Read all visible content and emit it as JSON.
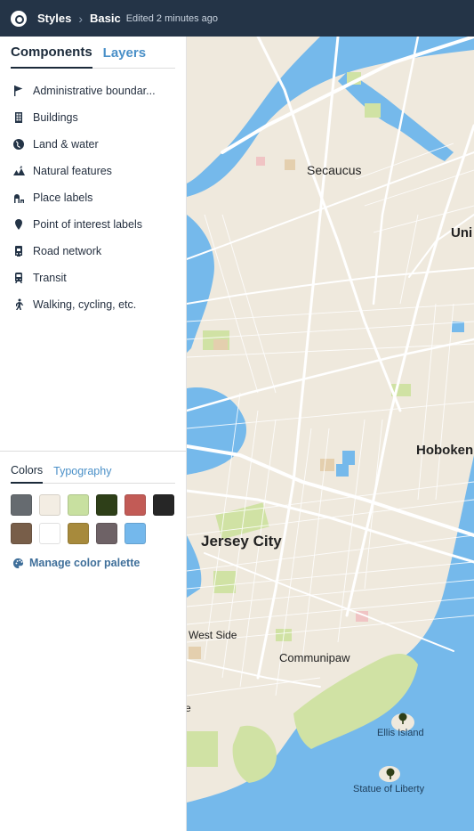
{
  "topbar": {
    "logo_icon": "mapbox-logo-icon",
    "styles_label": "Styles",
    "basic_label": "Basic",
    "edited_text": "Edited 2 minutes ago"
  },
  "sidebar": {
    "tabs": [
      {
        "label": "Components",
        "active": true
      },
      {
        "label": "Layers",
        "active": false
      }
    ],
    "components": [
      {
        "label": "Administrative boundar...",
        "icon": "flag-icon"
      },
      {
        "label": "Buildings",
        "icon": "building-icon"
      },
      {
        "label": "Land & water",
        "icon": "globe-icon"
      },
      {
        "label": "Natural features",
        "icon": "mountain-icon"
      },
      {
        "label": "Place labels",
        "icon": "place-label-icon"
      },
      {
        "label": "Point of interest labels",
        "icon": "marker-icon"
      },
      {
        "label": "Road network",
        "icon": "road-icon"
      },
      {
        "label": "Transit",
        "icon": "train-icon"
      },
      {
        "label": "Walking, cycling, etc.",
        "icon": "walking-icon"
      }
    ],
    "color_tabs": [
      {
        "label": "Colors",
        "active": true
      },
      {
        "label": "Typography",
        "active": false
      }
    ],
    "swatches": [
      "#666b70",
      "#f3ede3",
      "#c8e0a0",
      "#2e3f18",
      "#c25b56",
      "#262626",
      "#785e49",
      "#ffffff",
      "#a78a3c",
      "#6e6266",
      "#74b8ec"
    ],
    "manage_label": "Manage color palette",
    "manage_icon": "palette-icon"
  },
  "map": {
    "labels": {
      "secaucus": "Secaucus",
      "uni": "Uni",
      "hoboken": "Hoboken",
      "jersey_city": "Jersey City",
      "west_side": "West Side",
      "communipaw": "Communipaw",
      "e": "e",
      "ellis_island": "Ellis Island",
      "statue_of_liberty": "Statue of Liberty"
    },
    "colors": {
      "land": "#efe9dd",
      "water": "#75b9eb",
      "park": "#d0e2a4",
      "road": "#ffffff"
    },
    "poi_icon": "park-tree-icon"
  }
}
